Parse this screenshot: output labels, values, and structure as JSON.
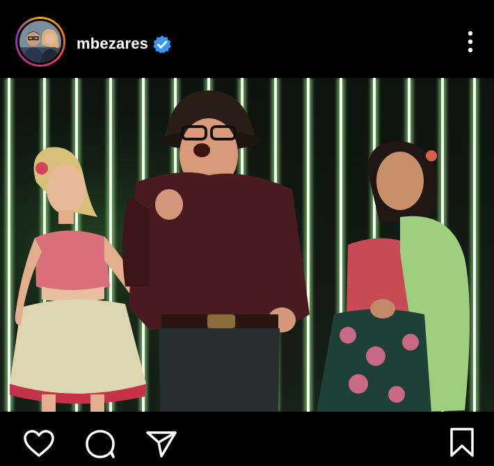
{
  "post": {
    "username": "mbezares",
    "verified": true
  },
  "icons": {
    "avatar": "profile-avatar",
    "verified": "verified-badge-icon",
    "more": "more-vertical-icon",
    "like": "heart-icon",
    "comment": "comment-icon",
    "share": "send-icon",
    "save": "bookmark-icon"
  },
  "colors": {
    "background": "#000000",
    "verified_blue": "#3897f0",
    "text": "#ffffff"
  }
}
